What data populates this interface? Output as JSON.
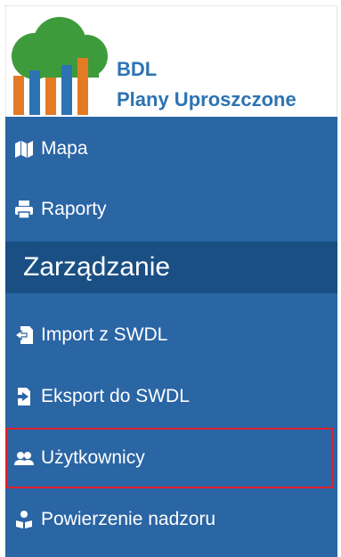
{
  "brand": {
    "title": "BDL",
    "subtitle": "Plany Uproszczone",
    "colors": {
      "text": "#2d73b3",
      "cloud": "#3a9a3a"
    }
  },
  "menu": {
    "background": "#2a65a4",
    "items": [
      {
        "label": "Mapa",
        "icon": "map-icon"
      },
      {
        "label": "Raporty",
        "icon": "printer-icon"
      }
    ],
    "section_title": "Zarządzanie",
    "section_items": [
      {
        "label": "Import z SWDL",
        "icon": "file-import-icon"
      },
      {
        "label": "Eksport do SWDL",
        "icon": "file-export-icon"
      },
      {
        "label": "Użytkownicy",
        "icon": "users-icon",
        "highlighted": true
      },
      {
        "label": "Powierzenie nadzoru",
        "icon": "user-delegate-icon"
      }
    ]
  }
}
